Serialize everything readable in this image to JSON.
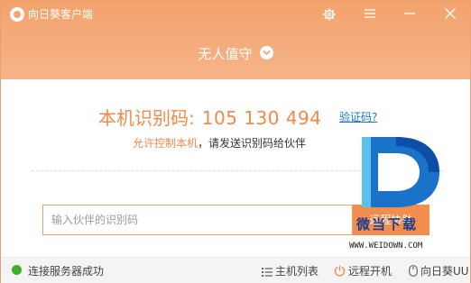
{
  "app": {
    "title": "向日葵客户端"
  },
  "mode": {
    "label": "无人值守"
  },
  "identity": {
    "label": "本机识别码:",
    "code": "105 130 494",
    "verify_link": "验证码?"
  },
  "description": {
    "allow": "允许控制本机",
    "rest": "，请发送识别码给伙伴"
  },
  "partner": {
    "placeholder": "输入伙伴的识别码",
    "connect_label": "远程协助"
  },
  "status": {
    "text": "连接服务器成功",
    "host_list": "主机列表",
    "remote_wake": "远程开机",
    "uu": "向日葵UU"
  },
  "watermark": {
    "title": "微当下载",
    "url": "WWW.WEIDOWN.COM"
  },
  "colors": {
    "accent": "#f08a4b",
    "header_top": "#f3a26c",
    "status_ok": "#3cb02a",
    "link": "#1a73c8"
  },
  "icons": {
    "settings": "gear-icon",
    "menu": "menu-icon",
    "minimize": "minimize-icon",
    "close": "close-icon",
    "mode_toggle": "chevron-down-icon",
    "host_list": "list-icon",
    "remote_wake": "power-icon",
    "uu": "mouse-icon"
  }
}
